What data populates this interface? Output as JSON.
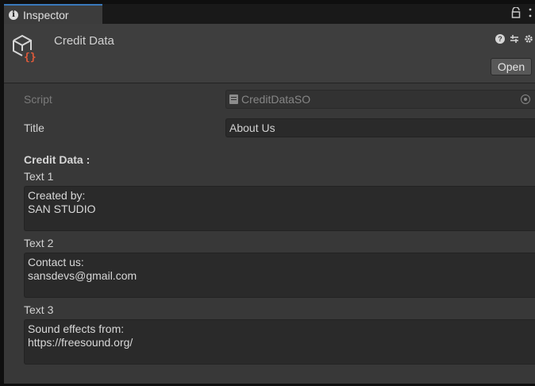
{
  "tab": {
    "label": "Inspector"
  },
  "header": {
    "title": "Credit Data",
    "open_label": "Open",
    "icons": [
      "help-icon",
      "preset-icon",
      "settings-icon"
    ]
  },
  "script_row": {
    "label": "Script",
    "value": "CreditDataSO"
  },
  "title_row": {
    "label": "Title",
    "value": "About Us"
  },
  "credit": {
    "heading": "Credit Data :",
    "texts": [
      {
        "label": "Text 1",
        "value": "Created by:\nSAN STUDIO"
      },
      {
        "label": "Text 2",
        "value": "Contact us:\nsansdevs@gmail.com"
      },
      {
        "label": "Text 3",
        "value": "Sound effects from:\nhttps://freesound.org/"
      }
    ]
  },
  "colors": {
    "accent": "#3a79bb",
    "asset_icon_brace": "#e05a3a",
    "panel_bg": "#383838"
  }
}
